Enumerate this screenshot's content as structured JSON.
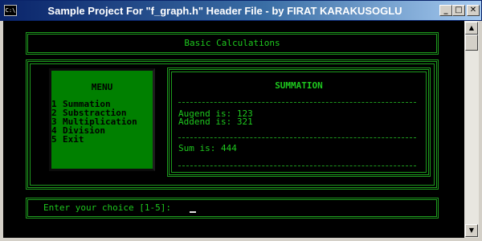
{
  "window": {
    "icon_text": "C:\\",
    "title": "Sample Project For \"f_graph.h\" Header File - by FIRAT KARAKUSOGLU",
    "minimize_glyph": "_",
    "maximize_glyph": "□",
    "close_glyph": "✕"
  },
  "scrollbar": {
    "up_glyph": "▲",
    "down_glyph": "▼"
  },
  "header": {
    "title": "Basic Calculations"
  },
  "menu": {
    "title": "MENU",
    "items": [
      {
        "number": "1",
        "label": "Summation"
      },
      {
        "number": "2",
        "label": "Substraction"
      },
      {
        "number": "3",
        "label": "Multiplication"
      },
      {
        "number": "4",
        "label": "Division"
      },
      {
        "number": "5",
        "label": "Exit"
      }
    ]
  },
  "result": {
    "title": "SUMMATION",
    "augend_line": "Augend is: 123",
    "addend_line": "Addend is: 321",
    "sum_line": "Sum is: 444"
  },
  "prompt": {
    "text": "Enter your choice [1-5]:"
  },
  "colors": {
    "console_bg": "#000000",
    "console_green": "#1ec81e",
    "border_green": "#1e9a1e",
    "menu_bg": "#008000",
    "titlebar": "#0a246a"
  }
}
